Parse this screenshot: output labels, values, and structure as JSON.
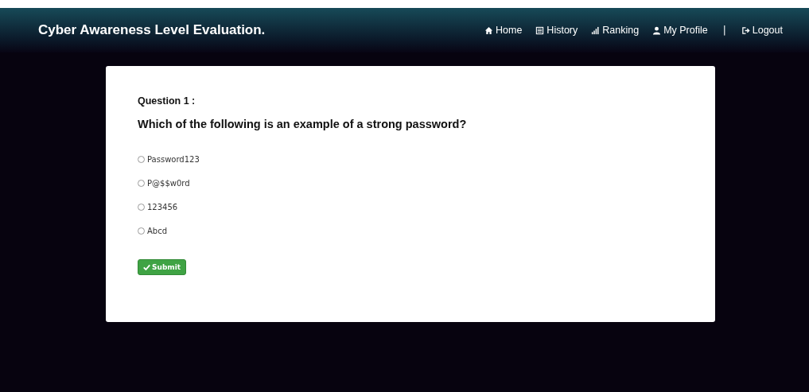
{
  "navbar": {
    "brand": "Cyber Awareness Level Evaluation.",
    "links": [
      {
        "label": "Home",
        "kind": "home"
      },
      {
        "label": "History",
        "kind": "history"
      },
      {
        "label": "Ranking",
        "kind": "ranking"
      },
      {
        "label": "My Profile",
        "kind": "profile"
      },
      {
        "label": "|",
        "kind": "separator"
      },
      {
        "label": "Logout",
        "kind": "logout"
      }
    ]
  },
  "quiz": {
    "question_label": "Question  1 :",
    "question": "Which of the following is an example of a strong password?",
    "options": [
      {
        "label": " Password123",
        "selected": false
      },
      {
        "label": "P@$$w0rd",
        "selected": false
      },
      {
        "label": "123456",
        "selected": false
      },
      {
        "label": "Abcd",
        "selected": false
      }
    ],
    "submit": "Submit"
  }
}
